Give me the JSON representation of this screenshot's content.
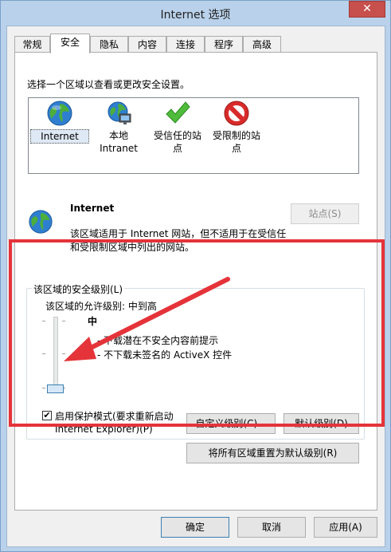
{
  "window": {
    "title": "Internet 选项",
    "close_glyph": "✕"
  },
  "tabs": [
    {
      "label": "常规"
    },
    {
      "label": "安全"
    },
    {
      "label": "隐私"
    },
    {
      "label": "内容"
    },
    {
      "label": "连接"
    },
    {
      "label": "程序"
    },
    {
      "label": "高级"
    }
  ],
  "active_tab": "安全",
  "security": {
    "prompt": "选择一个区域以查看或更改安全设置。",
    "zones": [
      {
        "line1": "Internet",
        "line2": "",
        "icon": "globe-icon"
      },
      {
        "line1": "本地",
        "line2": "Intranet",
        "icon": "intranet-icon"
      },
      {
        "line1": "受信任的站",
        "line2": "点",
        "icon": "checkmark-icon"
      },
      {
        "line1": "受限制的站",
        "line2": "点",
        "icon": "restricted-icon"
      }
    ],
    "selected_zone": "Internet",
    "zone_title": "Internet",
    "zone_desc_line1": "该区域适用于 Internet 网站，但不适用于在受信任",
    "zone_desc_line2": "和受限制区域中列出的网站。",
    "sites_button": "站点(S)",
    "level_group_label": "该区域的安全级别(L)",
    "allowed_levels_label": "该区域的允许级别: 中到高",
    "current_level": "中",
    "level_items": [
      "- 下载潜在不安全内容前提示",
      "- 不下载未签名的 ActiveX 控件"
    ],
    "protected_mode_line1": "启用保护模式(要求重新启动",
    "protected_mode_line2": "Internet Explorer)(P)",
    "protected_mode_checked": true,
    "checkbox_glyph": "✔",
    "custom_level_button": "自定义级别(C)...",
    "default_level_button": "默认级别(D)",
    "reset_all_button": "将所有区域重置为默认级别(R)"
  },
  "footer": {
    "ok": "确定",
    "cancel": "取消",
    "apply": "应用(A)"
  },
  "colors": {
    "annotation_red": "#e5333a",
    "accent_blue": "#3c7fb1"
  }
}
